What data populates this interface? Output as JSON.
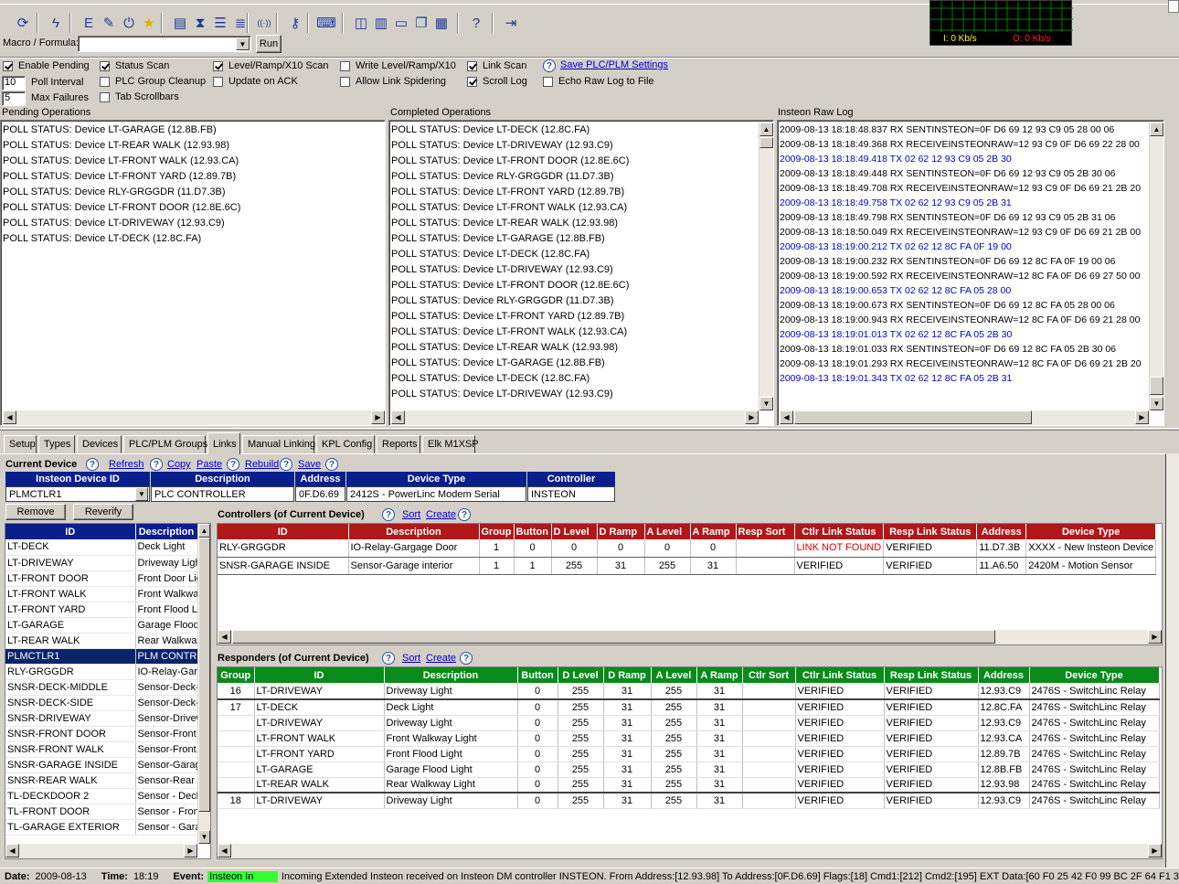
{
  "toolbar": {
    "icons": [
      "refresh-icon",
      "lightning-icon",
      "event-icon",
      "edit-icon",
      "power-icon",
      "star-icon",
      "document-icon",
      "hourglass-icon",
      "tree-icon",
      "list-icon",
      "signal-icon",
      "key-icon",
      "keyboard-icon",
      "tile-horizontal-icon",
      "tile-vertical-icon",
      "window-icon",
      "cascade-icon",
      "grid-icon",
      "help-icon",
      "exit-icon"
    ]
  },
  "traffic": {
    "in_label": "I: 0 Kb/s",
    "out_label": "O: 0 Kb/s",
    "in_color": "#ffff00",
    "out_color": "#ff2020"
  },
  "macro": {
    "label": "Macro / Formula:",
    "value": "",
    "run_label": "Run"
  },
  "options": {
    "enable_pending": {
      "label": "Enable Pending",
      "checked": true
    },
    "status_scan": {
      "label": "Status Scan",
      "checked": true
    },
    "level_scan": {
      "label": "Level/Ramp/X10 Scan",
      "checked": true
    },
    "write_level": {
      "label": "Write Level/Ramp/X10",
      "checked": false
    },
    "link_scan": {
      "label": "Link Scan",
      "checked": true
    },
    "save_settings": "Save PLC/PLM Settings",
    "poll_interval_value": "10",
    "poll_interval_label": "Poll Interval",
    "plc_cleanup": {
      "label": "PLC Group Cleanup",
      "checked": false
    },
    "update_on_ack": {
      "label": "Update on ACK",
      "checked": false
    },
    "allow_spidering": {
      "label": "Allow Link Spidering",
      "checked": false
    },
    "scroll_log": {
      "label": "Scroll Log",
      "checked": true
    },
    "echo_raw": {
      "label": "Echo Raw Log to File",
      "checked": false
    },
    "max_failures_value": "5",
    "max_failures_label": "Max Failures",
    "tab_scrollbars": {
      "label": "Tab Scrollbars",
      "checked": false
    }
  },
  "pending": {
    "title": "Pending Operations",
    "rows": [
      "POLL STATUS: Device LT-GARAGE (12.8B.FB)",
      "POLL STATUS: Device LT-REAR WALK (12.93.98)",
      "POLL STATUS: Device LT-FRONT WALK (12.93.CA)",
      "POLL STATUS: Device LT-FRONT YARD (12.89.7B)",
      "POLL STATUS: Device RLY-GRGGDR (11.D7.3B)",
      "POLL STATUS: Device LT-FRONT DOOR (12.8E.6C)",
      "POLL STATUS: Device LT-DRIVEWAY (12.93.C9)",
      "POLL STATUS: Device LT-DECK (12.8C.FA)"
    ]
  },
  "completed": {
    "title": "Completed Operations",
    "rows": [
      "POLL STATUS: Device LT-DECK (12.8C.FA)",
      "POLL STATUS: Device LT-DRIVEWAY (12.93.C9)",
      "POLL STATUS: Device LT-FRONT DOOR (12.8E.6C)",
      "POLL STATUS: Device RLY-GRGGDR (11.D7.3B)",
      "POLL STATUS: Device LT-FRONT YARD (12.89.7B)",
      "POLL STATUS: Device LT-FRONT WALK (12.93.CA)",
      "POLL STATUS: Device LT-REAR WALK (12.93.98)",
      "POLL STATUS: Device LT-GARAGE (12.8B.FB)",
      "POLL STATUS: Device LT-DECK (12.8C.FA)",
      "POLL STATUS: Device LT-DRIVEWAY (12.93.C9)",
      "POLL STATUS: Device LT-FRONT DOOR (12.8E.6C)",
      "POLL STATUS: Device RLY-GRGGDR (11.D7.3B)",
      "POLL STATUS: Device LT-FRONT YARD (12.89.7B)",
      "POLL STATUS: Device LT-FRONT WALK (12.93.CA)",
      "POLL STATUS: Device LT-REAR WALK (12.93.98)",
      "POLL STATUS: Device LT-GARAGE (12.8B.FB)",
      "POLL STATUS: Device LT-DECK (12.8C.FA)",
      "POLL STATUS: Device LT-DRIVEWAY (12.93.C9)"
    ]
  },
  "rawlog": {
    "title": "Insteon Raw Log",
    "rows": [
      {
        "t": "2009-08-13 18:18:48.837  RX  SENTINSTEON=0F D6 69 12 93 C9 05 28 00 06",
        "tx": false
      },
      {
        "t": "2009-08-13 18:18:49.368  RX  RECEIVEINSTEONRAW=12 93 C9 0F D6 69 22 28 00",
        "tx": false
      },
      {
        "t": "2009-08-13 18:18:49.418  TX  02 62 12 93 C9 05 2B 30",
        "tx": true
      },
      {
        "t": "2009-08-13 18:18:49.448  RX  SENTINSTEON=0F D6 69 12 93 C9 05 2B 30 06",
        "tx": false
      },
      {
        "t": "2009-08-13 18:18:49.708  RX  RECEIVEINSTEONRAW=12 93 C9 0F D6 69 21 2B 20",
        "tx": false
      },
      {
        "t": "2009-08-13 18:18:49.758  TX  02 62 12 93 C9 05 2B 31",
        "tx": true
      },
      {
        "t": "2009-08-13 18:18:49.798  RX  SENTINSTEON=0F D6 69 12 93 C9 05 2B 31 06",
        "tx": false
      },
      {
        "t": "2009-08-13 18:18:50.049  RX  RECEIVEINSTEONRAW=12 93 C9 0F D6 69 21 2B 00",
        "tx": false
      },
      {
        "t": "2009-08-13 18:19:00.212  TX  02 62 12 8C FA 0F 19 00",
        "tx": true
      },
      {
        "t": "2009-08-13 18:19:00.232  RX  SENTINSTEON=0F D6 69 12 8C FA 0F 19 00 06",
        "tx": false
      },
      {
        "t": "2009-08-13 18:19:00.592  RX  RECEIVEINSTEONRAW=12 8C FA 0F D6 69 27 50 00",
        "tx": false
      },
      {
        "t": "2009-08-13 18:19:00.653  TX  02 62 12 8C FA 05 28 00",
        "tx": true
      },
      {
        "t": "2009-08-13 18:19:00.673  RX  SENTINSTEON=0F D6 69 12 8C FA 05 28 00 06",
        "tx": false
      },
      {
        "t": "2009-08-13 18:19:00.943  RX  RECEIVEINSTEONRAW=12 8C FA 0F D6 69 21 28 00",
        "tx": false
      },
      {
        "t": "2009-08-13 18:19:01.013  TX  02 62 12 8C FA 05 2B 30",
        "tx": true
      },
      {
        "t": "2009-08-13 18:19:01.033  RX  SENTINSTEON=0F D6 69 12 8C FA 05 2B 30 06",
        "tx": false
      },
      {
        "t": "2009-08-13 18:19:01.293  RX  RECEIVEINSTEONRAW=12 8C FA 0F D6 69 21 2B 20",
        "tx": false
      },
      {
        "t": "2009-08-13 18:19:01.343  TX  02 62 12 8C FA 05 2B 31",
        "tx": true
      },
      {
        "t": "2009-08-13 18:19:01.363  RX  SENTINSTEON=0F D6 69 12 8C FA 05 2B 31 06",
        "tx": false
      }
    ]
  },
  "tabs": [
    "Setup",
    "Types",
    "Devices",
    "PLC/PLM Groups",
    "Links",
    "Manual Linking",
    "KPL Config",
    "Reports",
    "Elk M1XSP"
  ],
  "active_tab": "Links",
  "current_device": {
    "label": "Current Device",
    "refresh": "Refresh",
    "copy": "Copy",
    "paste": "Paste",
    "rebuild": "Rebuild",
    "save": "Save",
    "headers": [
      "Insteon Device ID",
      "Description",
      "Address",
      "Device Type",
      "Controller"
    ],
    "values": [
      "PLMCTLR1",
      "PLC CONTROLLER",
      "0F.D6.69",
      "2412S - PowerLinc Modem Serial",
      "INSTEON"
    ]
  },
  "buttons": {
    "remove": "Remove",
    "reverify": "Reverify"
  },
  "device_list": {
    "headers": [
      "ID",
      "Description"
    ],
    "rows": [
      [
        "LT-DECK",
        "Deck Light"
      ],
      [
        "LT-DRIVEWAY",
        "Driveway Light"
      ],
      [
        "LT-FRONT DOOR",
        "Front Door Light"
      ],
      [
        "LT-FRONT WALK",
        "Front Walkway Light"
      ],
      [
        "LT-FRONT YARD",
        "Front Flood Light"
      ],
      [
        "LT-GARAGE",
        "Garage Flood Light"
      ],
      [
        "LT-REAR WALK",
        "Rear Walkway Light"
      ],
      [
        "PLMCTLR1",
        "PLM CONTROLLER"
      ],
      [
        "RLY-GRGGDR",
        "IO-Relay-Gargage Door"
      ],
      [
        "SNSR-DECK-MIDDLE",
        "Sensor-Deck-Middle"
      ],
      [
        "SNSR-DECK-SIDE",
        "Sensor-Deck-Side"
      ],
      [
        "SNSR-DRIVEWAY",
        "Sensor-Driveway"
      ],
      [
        "SNSR-FRONT DOOR",
        "Sensor-Front Door"
      ],
      [
        "SNSR-FRONT WALK",
        "Sensor-Front Walk"
      ],
      [
        "SNSR-GARAGE INSIDE",
        "Sensor-Garage Inside"
      ],
      [
        "SNSR-REAR WALK",
        "Sensor-Rear Walk"
      ],
      [
        "TL-DECKDOOR 2",
        "Sensor - Deck Door"
      ],
      [
        "TL-FRONT DOOR",
        "Sensor - Front Door"
      ],
      [
        "TL-GARAGE EXTERIOR",
        "Sensor - Garage Exterior"
      ]
    ],
    "selected": 7
  },
  "controllers": {
    "title": "Controllers (of Current Device)",
    "sort": "Sort",
    "create": "Create",
    "headers": [
      "ID",
      "Description",
      "Group",
      "Button",
      "D Level",
      "D Ramp",
      "A Level",
      "A Ramp",
      "Resp Sort",
      "Ctlr Link Status",
      "Resp Link Status",
      "Address",
      "Device Type"
    ],
    "rows": [
      [
        "RLY-GRGGDR",
        "IO-Relay-Gargage Door",
        "1",
        "0",
        "0",
        "0",
        "0",
        "0",
        "",
        "LINK NOT FOUND",
        "VERIFIED",
        "11.D7.3B",
        "XXXX - New Insteon Device"
      ],
      [
        "SNSR-GARAGE INSIDE",
        "Sensor-Garage interior",
        "1",
        "1",
        "255",
        "31",
        "255",
        "31",
        "",
        "VERIFIED",
        "VERIFIED",
        "11.A6.50",
        "2420M - Motion Sensor"
      ]
    ]
  },
  "responders": {
    "title": "Responders (of Current Device)",
    "sort": "Sort",
    "create": "Create",
    "headers": [
      "Group",
      "ID",
      "Description",
      "Button",
      "D Level",
      "D Ramp",
      "A Level",
      "A Ramp",
      "Ctlr Sort",
      "Ctlr Link Status",
      "Resp Link Status",
      "Address",
      "Device Type"
    ],
    "rows": [
      [
        "16",
        "LT-DRIVEWAY",
        "Driveway Light",
        "0",
        "255",
        "31",
        "255",
        "31",
        "",
        "VERIFIED",
        "VERIFIED",
        "12.93.C9",
        "2476S - SwitchLinc Relay"
      ],
      [
        "17",
        "LT-DECK",
        "Deck Light",
        "0",
        "255",
        "31",
        "255",
        "31",
        "",
        "VERIFIED",
        "VERIFIED",
        "12.8C.FA",
        "2476S - SwitchLinc Relay"
      ],
      [
        "",
        "LT-DRIVEWAY",
        "Driveway Light",
        "0",
        "255",
        "31",
        "255",
        "31",
        "",
        "VERIFIED",
        "VERIFIED",
        "12.93.C9",
        "2476S - SwitchLinc Relay"
      ],
      [
        "",
        "LT-FRONT WALK",
        "Front Walkway Light",
        "0",
        "255",
        "31",
        "255",
        "31",
        "",
        "VERIFIED",
        "VERIFIED",
        "12.93.CA",
        "2476S - SwitchLinc Relay"
      ],
      [
        "",
        "LT-FRONT YARD",
        "Front Flood Light",
        "0",
        "255",
        "31",
        "255",
        "31",
        "",
        "VERIFIED",
        "VERIFIED",
        "12.89.7B",
        "2476S - SwitchLinc Relay"
      ],
      [
        "",
        "LT-GARAGE",
        "Garage Flood Light",
        "0",
        "255",
        "31",
        "255",
        "31",
        "",
        "VERIFIED",
        "VERIFIED",
        "12.8B.FB",
        "2476S - SwitchLinc Relay"
      ],
      [
        "",
        "LT-REAR WALK",
        "Rear Walkway Light",
        "0",
        "255",
        "31",
        "255",
        "31",
        "",
        "VERIFIED",
        "VERIFIED",
        "12.93.98",
        "2476S - SwitchLinc Relay"
      ],
      [
        "18",
        "LT-DRIVEWAY",
        "Driveway Light",
        "0",
        "255",
        "31",
        "255",
        "31",
        "",
        "VERIFIED",
        "VERIFIED",
        "12.93.C9",
        "2476S - SwitchLinc Relay"
      ]
    ]
  },
  "status_bar": {
    "date_label": "Date:",
    "date": "2009-08-13",
    "time_label": "Time:",
    "time": "18:19",
    "event_label": "Event:",
    "event": "Insteon In",
    "message": "Incoming Extended Insteon received on Insteon DM controller INSTEON. From Address:[12.93.98] To Address:[0F.D6.69] Flags:[18] Cmd1:[212] Cmd2:[195] EXT Data:[60 F0 25 42 F0 99 BC 2F 64 F1 3"
  }
}
